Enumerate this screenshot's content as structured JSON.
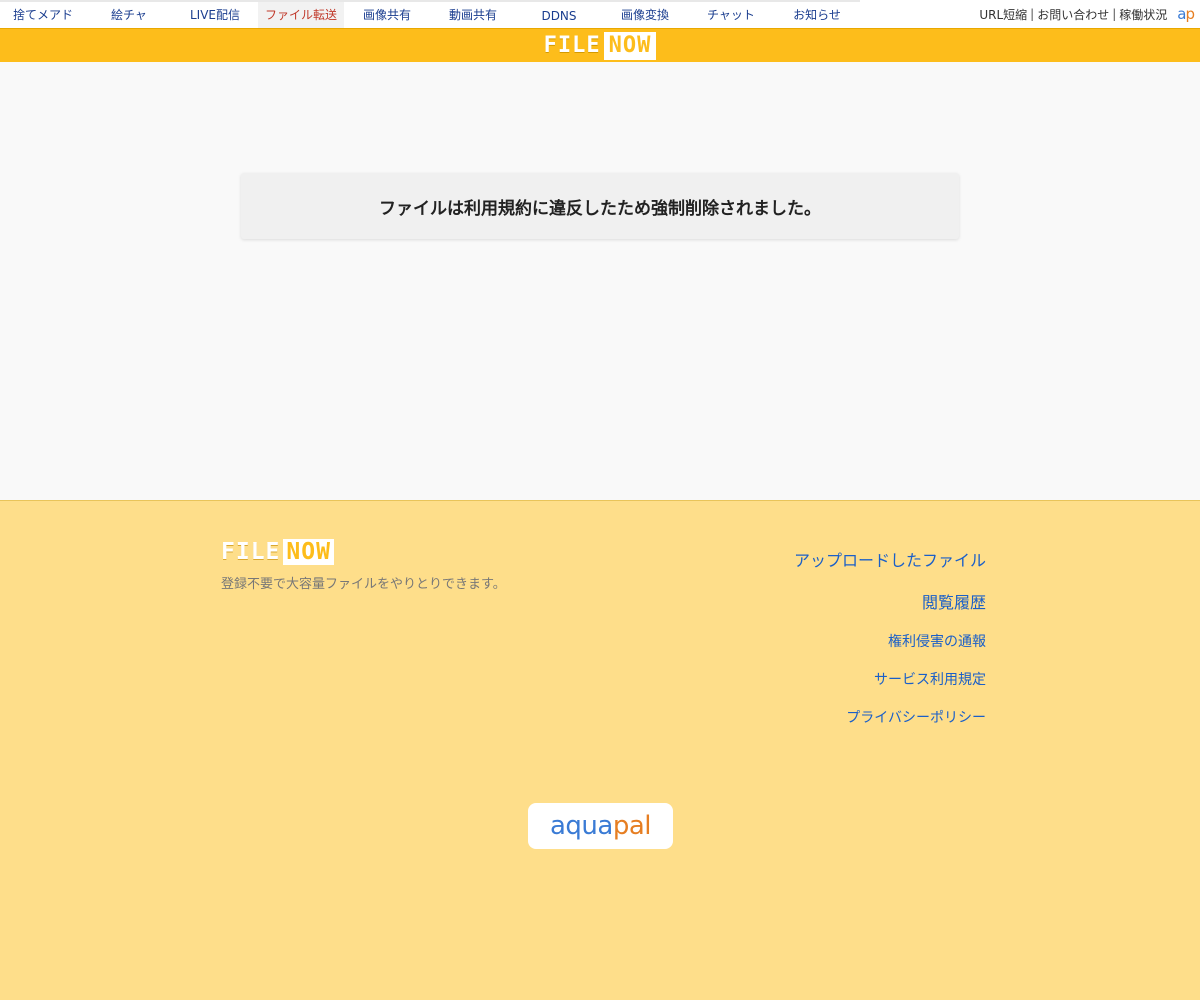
{
  "topnav": {
    "tabs": [
      {
        "label": "捨てメアド",
        "active": false
      },
      {
        "label": "絵チャ",
        "active": false
      },
      {
        "label": "LIVE配信",
        "active": false
      },
      {
        "label": "ファイル転送",
        "active": true
      },
      {
        "label": "画像共有",
        "active": false
      },
      {
        "label": "動画共有",
        "active": false
      },
      {
        "label": "DDNS",
        "active": false
      },
      {
        "label": "画像変換",
        "active": false
      },
      {
        "label": "チャット",
        "active": false
      },
      {
        "label": "お知らせ",
        "active": false
      }
    ],
    "util_links": [
      "URL短縮",
      "お問い合わせ",
      "稼働状況"
    ],
    "separator": "|",
    "ap_badge": {
      "a": "a",
      "p": "p"
    }
  },
  "header": {
    "logo_file": "FILE",
    "logo_now": "NOW"
  },
  "main": {
    "notice": "ファイルは利用規約に違反したため強制削除されました。"
  },
  "footer": {
    "logo_file": "FILE",
    "logo_now": "NOW",
    "tagline": "登録不要で大容量ファイルをやりとりできます。",
    "links": [
      {
        "label": "アップロードしたファイル",
        "size": "big"
      },
      {
        "label": "閲覧履歴",
        "size": "big"
      },
      {
        "label": "権利侵害の通報",
        "size": "small"
      },
      {
        "label": "サービス利用規定",
        "size": "small"
      },
      {
        "label": "プライバシーポリシー",
        "size": "small"
      }
    ],
    "aquapal": {
      "aqua": "aqua",
      "pal": "pal"
    }
  },
  "colors": {
    "brand_yellow": "#fdbd1b",
    "footer_bg": "#fede8a",
    "link_blue": "#1a5fc8",
    "active_tab_red": "#c0392b"
  }
}
